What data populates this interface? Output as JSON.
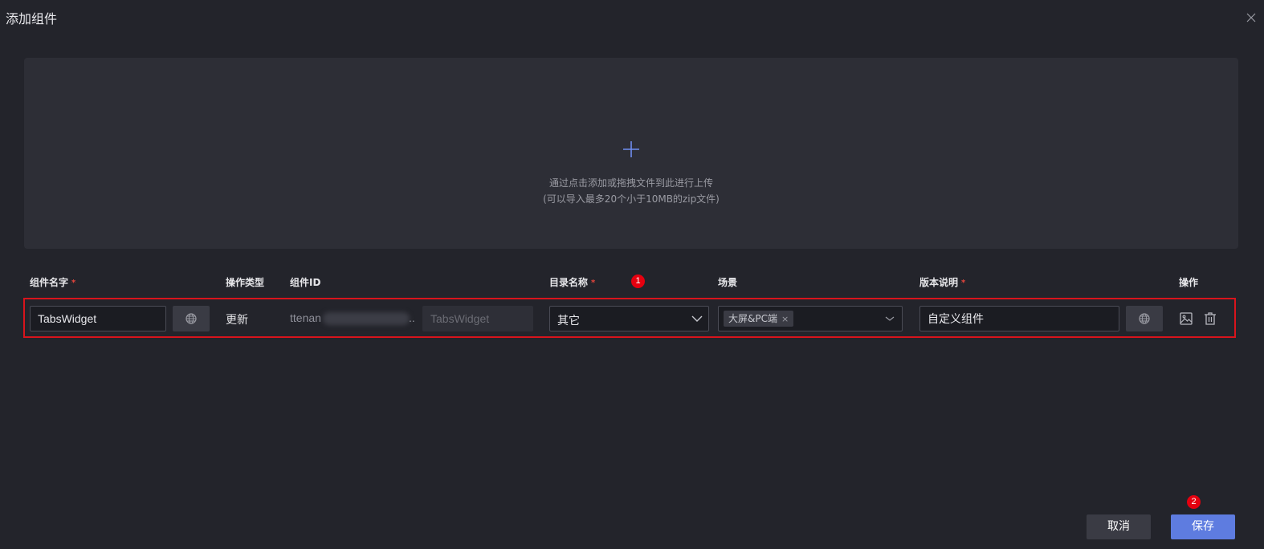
{
  "dialog": {
    "title": "添加组件",
    "close_icon": "close-icon"
  },
  "upload": {
    "icon": "plus-icon",
    "hint_line1": "通过点击添加或拖拽文件到此进行上传",
    "hint_line2": "(可以导入最多20个小于10MB的zip文件)"
  },
  "table": {
    "columns": {
      "name": "组件名字",
      "op_type": "操作类型",
      "id": "组件ID",
      "catalog": "目录名称",
      "scene": "场景",
      "version_note": "版本说明",
      "actions": "操作"
    },
    "required_mark": "*",
    "row": {
      "name_value": "TabsWidget",
      "op_type": "更新",
      "id_prefix": "ttenan",
      "id_ellipsis": "..",
      "id_suffix_value": "TabsWidget",
      "catalog_value": "其它",
      "scene_tag": "大屏&PC端",
      "scene_tag_remove": "×",
      "version_note_value": "自定义组件"
    }
  },
  "badges": {
    "catalog_step": "1",
    "save_step": "2"
  },
  "footer": {
    "cancel_label": "取消",
    "save_label": "保存"
  },
  "colors": {
    "background": "#23242b",
    "upload_bg": "#2d2e36",
    "highlight_border": "#d8141c",
    "primary": "#5e7ce0",
    "badge": "#e5000f"
  }
}
